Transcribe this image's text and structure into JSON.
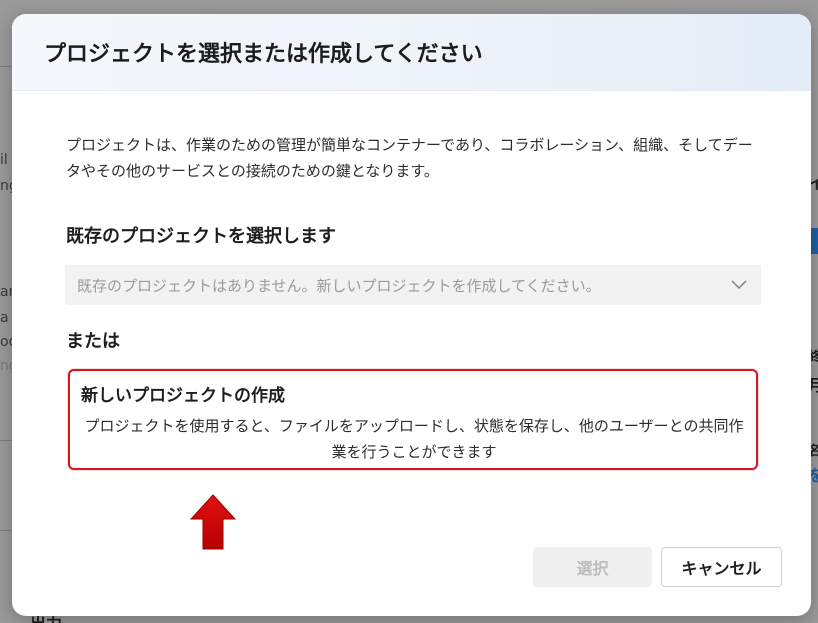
{
  "dialog": {
    "title": "プロジェクトを選択または作成してください",
    "description": "プロジェクトは、作業のための管理が簡単なコンテナーであり、コラボレーション、組織、そしてデータやその他のサービスとの接続のための鍵となります。",
    "existing_section": {
      "label": "既存のプロジェクトを選択します",
      "select_value": "既存のプロジェクトはありません。新しいプロジェクトを作成してください。",
      "chevron_icon": "chevron-down-icon"
    },
    "or_label": "または",
    "new_project": {
      "title": "新しいプロジェクトの作成",
      "description": "プロジェクトを使用すると、ファイルをアップロードし、状態を保存し、他のユーザーとの共同作業を行うことができます",
      "highlight_color": "#d7151b"
    },
    "annotation_arrow": {
      "icon": "up-arrow-icon",
      "color": "#cc0000"
    },
    "buttons": {
      "select_label": "選択",
      "select_disabled": true,
      "cancel_label": "キャンセル"
    }
  },
  "background": {
    "left_fragments": [
      "il",
      "ng",
      "an",
      "a",
      "oo",
      "ng"
    ],
    "right_fragments": [
      "イ",
      "終",
      "月",
      "名",
      "を"
    ],
    "bottom_fragment": "出力"
  }
}
